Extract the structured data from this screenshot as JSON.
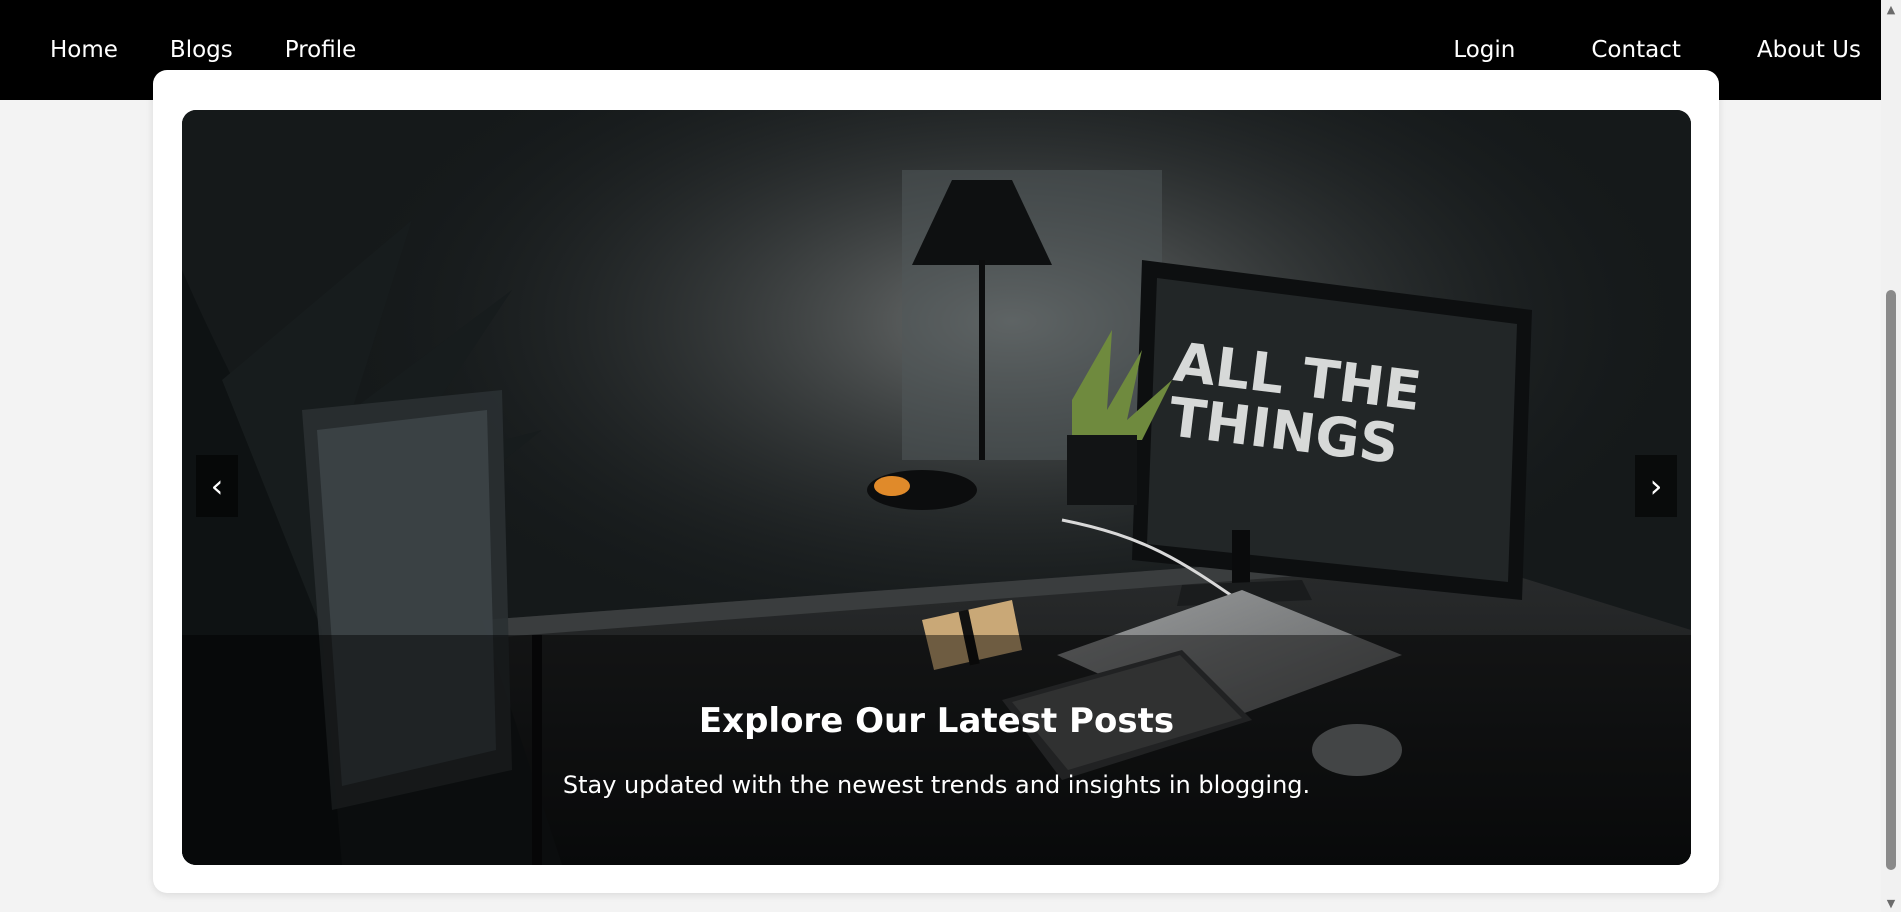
{
  "nav": {
    "left": [
      "Home",
      "Blogs",
      "Profile"
    ],
    "right": [
      "Login",
      "Contact",
      "About Us"
    ]
  },
  "carousel": {
    "prev_symbol": "‹",
    "next_symbol": "›",
    "slide": {
      "title": "Explore Our Latest Posts",
      "text": "Stay updated with the newest trends and insights in blogging.",
      "monitor_text_line1": "ALL THE",
      "monitor_text_line2": "THINGS"
    }
  },
  "colors": {
    "navbar_bg": "#000000",
    "page_bg": "#f3f3f3",
    "card_bg": "#ffffff"
  },
  "icons": {
    "prev": "chevron-left-icon",
    "next": "chevron-right-icon",
    "scroll_up": "triangle-up-icon",
    "scroll_down": "triangle-down-icon"
  }
}
